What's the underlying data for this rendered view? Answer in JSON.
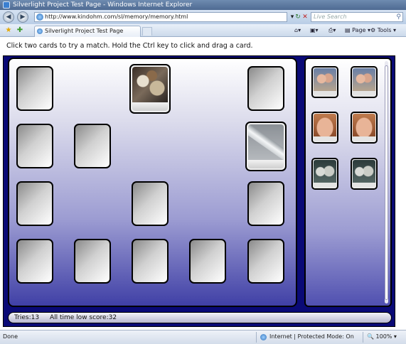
{
  "window": {
    "title": "Silverlight Project Test Page - Windows Internet Explorer"
  },
  "addressbar": {
    "url": "http://www.kindohm.com/sl/memory/memory.html",
    "search_placeholder": "Live Search"
  },
  "tab": {
    "title": "Silverlight Project Test Page"
  },
  "commands": {
    "page": "Page",
    "tools": "Tools"
  },
  "page": {
    "instruction": "Click two cards to try a match. Hold the Ctrl key to click and drag a card.",
    "tries_label": "Tries:13",
    "low_score_label": "All time low score:32"
  },
  "statusbar": {
    "status": "Done",
    "zone": "Internet | Protected Mode: On",
    "zoom": "100%"
  }
}
